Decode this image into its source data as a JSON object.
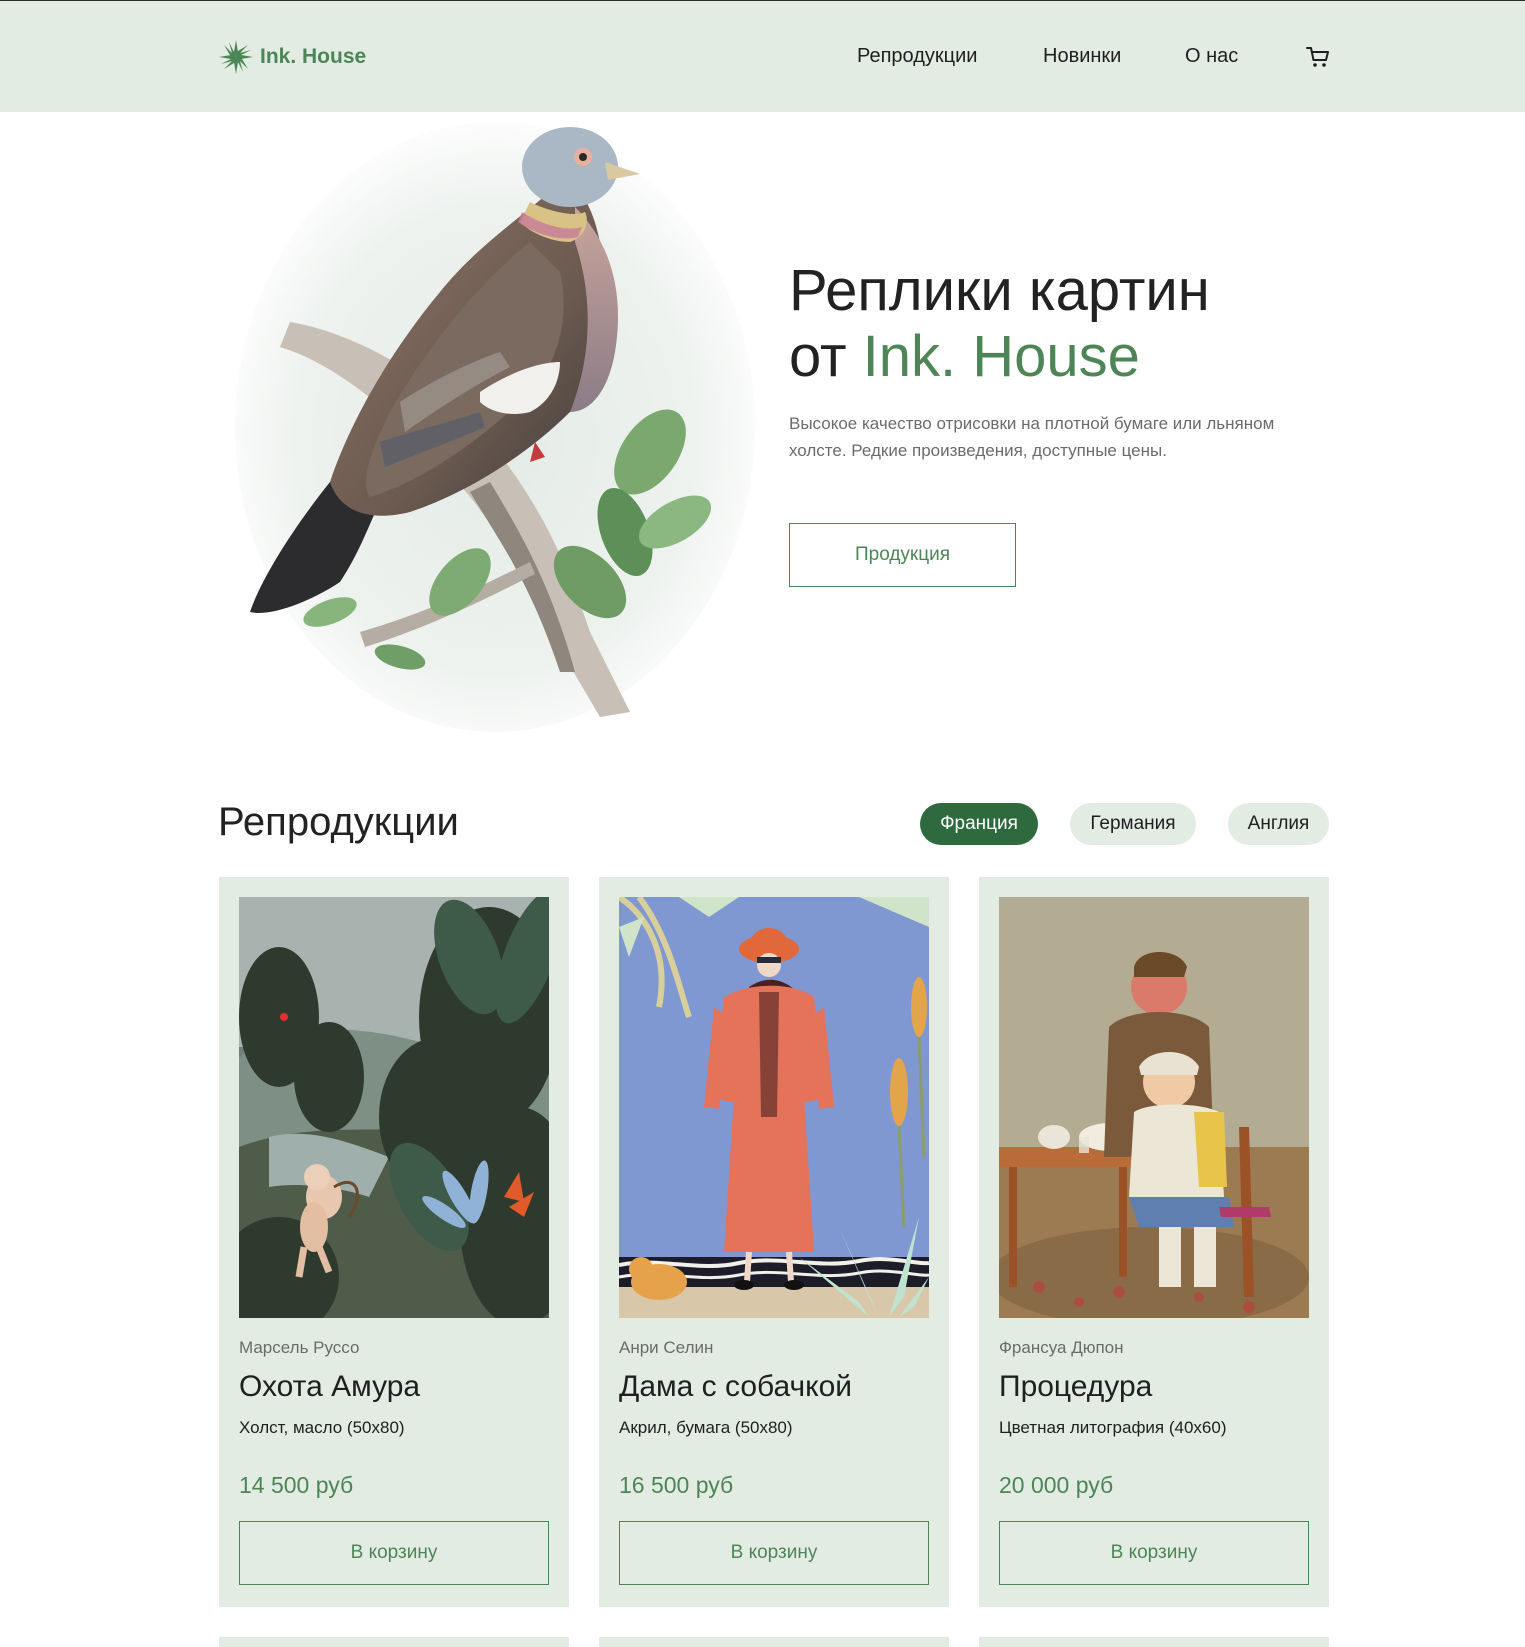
{
  "header": {
    "logo_text": "Ink. House",
    "nav": [
      {
        "label": "Репродукции"
      },
      {
        "label": "Новинки"
      },
      {
        "label": "О нас"
      }
    ]
  },
  "hero": {
    "title_line1": "Реплики картин",
    "title_prefix": "от ",
    "title_accent": "Ink. House",
    "description": "Высокое качество отрисовки на плотной бумаге или льняном холсте. Редкие произведения, доступные цены.",
    "button_label": "Продукция"
  },
  "catalog": {
    "title": "Репродукции",
    "filters": [
      {
        "label": "Франция",
        "active": true
      },
      {
        "label": "Германия",
        "active": false
      },
      {
        "label": "Англия",
        "active": false
      }
    ],
    "cards": [
      {
        "author": "Марсель Руссо",
        "title": "Охота Амура",
        "material": "Холст, масло (50x80)",
        "price": "14 500 руб",
        "button": "В корзину"
      },
      {
        "author": "Анри Селин",
        "title": "Дама с собачкой",
        "material": "Акрил, бумага (50x80)",
        "price": "16 500 руб",
        "button": "В корзину"
      },
      {
        "author": "Франсуа Дюпон",
        "title": "Процедура",
        "material": "Цветная литография (40x60)",
        "price": "20 000 руб",
        "button": "В корзину"
      }
    ]
  },
  "colors": {
    "accent": "#4e8556",
    "accent_dark": "#2f6a3e",
    "header_bg": "#e2ece3",
    "card_bg": "#e2ece3"
  },
  "icons": {
    "logo": "starburst-icon",
    "cart": "cart-icon"
  }
}
